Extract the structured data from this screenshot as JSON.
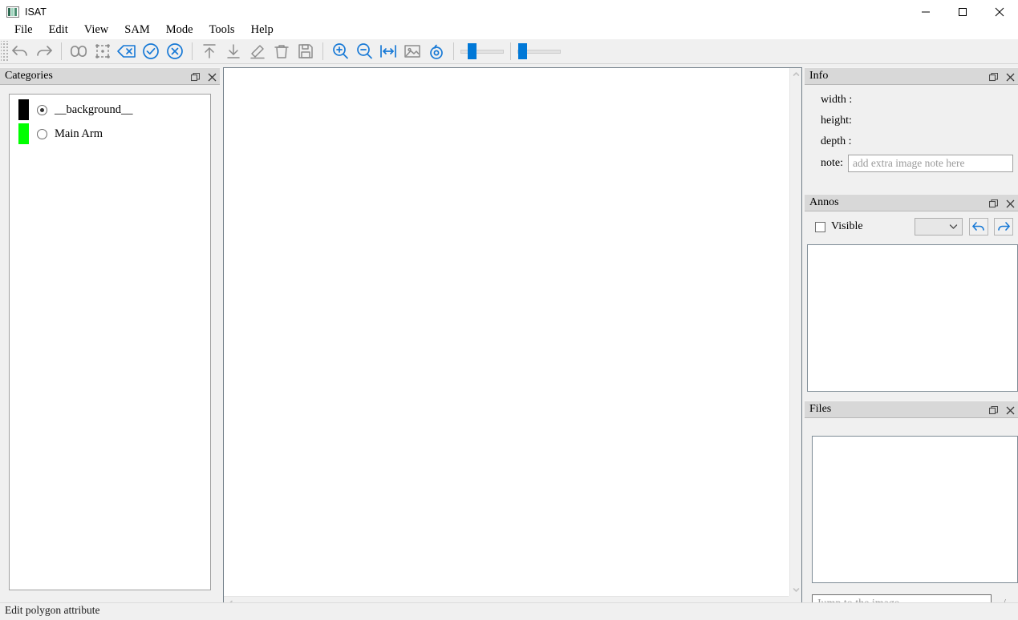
{
  "window": {
    "title": "ISAT",
    "app_icon": "isat-logo-icon",
    "controls": {
      "minimize": "minimize-icon",
      "maximize": "maximize-icon",
      "close": "close-icon"
    }
  },
  "menu": {
    "items": [
      {
        "label": "File"
      },
      {
        "label": "Edit"
      },
      {
        "label": "View"
      },
      {
        "label": "SAM"
      },
      {
        "label": "Mode"
      },
      {
        "label": "Tools"
      },
      {
        "label": "Help"
      }
    ]
  },
  "toolbar": {
    "buttons": [
      {
        "name": "undo-icon",
        "title": "Undo"
      },
      {
        "name": "redo-icon",
        "title": "Redo"
      },
      {
        "name": "segment-anything-icon",
        "title": "Segment anything"
      },
      {
        "name": "bounding-box-icon",
        "title": "Bounding box"
      },
      {
        "name": "delete-point-icon",
        "title": "Backspace"
      },
      {
        "name": "finish-check-icon",
        "title": "Finish"
      },
      {
        "name": "cancel-x-icon",
        "title": "Cancel"
      },
      {
        "name": "to-top-icon",
        "title": "To top"
      },
      {
        "name": "to-bottom-icon",
        "title": "To bottom"
      },
      {
        "name": "edit-pencil-icon",
        "title": "Edit"
      },
      {
        "name": "trash-icon",
        "title": "Delete"
      },
      {
        "name": "save-icon",
        "title": "Save"
      },
      {
        "name": "zoom-in-icon",
        "title": "Zoom in"
      },
      {
        "name": "zoom-out-icon",
        "title": "Zoom out"
      },
      {
        "name": "fit-window-icon",
        "title": "Fit window"
      },
      {
        "name": "image-icon",
        "title": "Show image"
      },
      {
        "name": "visibility-eye-icon",
        "title": "Visibility"
      }
    ],
    "sliders": [
      {
        "name": "mask-alpha-slider",
        "value": 25
      },
      {
        "name": "vertex-size-slider",
        "value": 4
      }
    ]
  },
  "categories_panel": {
    "title": "Categories",
    "float_icon": "float-panel-icon",
    "close_icon": "close-panel-icon",
    "items": [
      {
        "label": "__background__",
        "color": "#000000",
        "selected": true
      },
      {
        "label": "Main Arm",
        "color": "#00ff00",
        "selected": false
      }
    ]
  },
  "canvas": {
    "name": "image-canvas",
    "scroll_up_icon": "chevron-up-icon",
    "scroll_down_icon": "chevron-down-icon",
    "scroll_left_icon": "chevron-left-icon",
    "scroll_right_icon": "chevron-right-icon"
  },
  "info_panel": {
    "title": "Info",
    "float_icon": "float-panel-icon",
    "close_icon": "close-panel-icon",
    "fields": [
      {
        "key": "width :",
        "value": ""
      },
      {
        "key": "height:",
        "value": ""
      },
      {
        "key": "depth :",
        "value": ""
      }
    ],
    "note_label": "note:",
    "note_value": "",
    "note_placeholder": "add extra image note here"
  },
  "annos_panel": {
    "title": "Annos",
    "float_icon": "float-panel-icon",
    "close_icon": "close-panel-icon",
    "visible_label": "Visible",
    "visible_checked": false,
    "group_select_value": "",
    "prev_button_icon": "arrow-back-icon",
    "next_button_icon": "arrow-forward-icon",
    "items": []
  },
  "files_panel": {
    "title": "Files",
    "float_icon": "float-panel-icon",
    "close_icon": "close-panel-icon",
    "items": [],
    "jump_value": "",
    "jump_placeholder": "Jump to the image.",
    "page_separator": "/"
  },
  "statusbar": {
    "message": "Edit polygon attribute"
  },
  "theme": {
    "accent": "#0078d7",
    "icon_gray": "#8c8c8c",
    "panel_bg": "#f0f0f0",
    "panel_title_bg": "#d8d8d8"
  }
}
